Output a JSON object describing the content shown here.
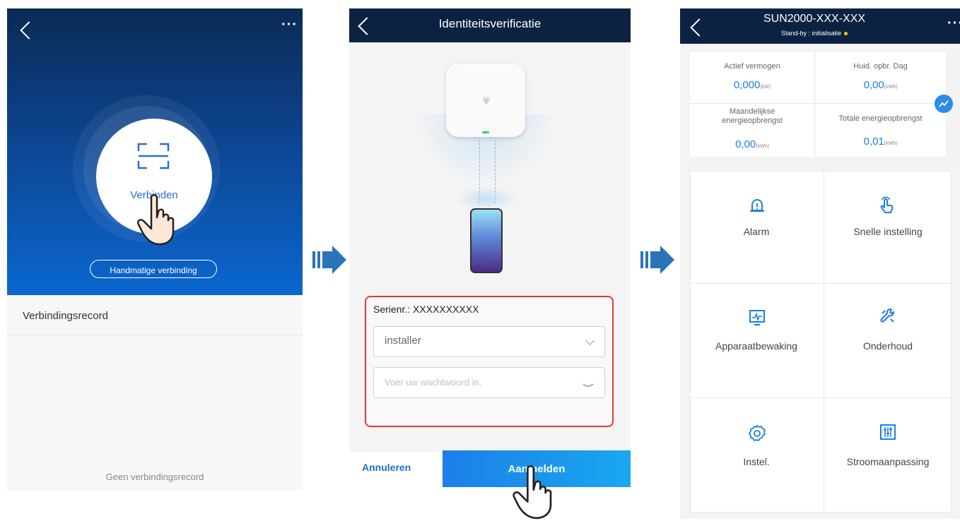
{
  "screen1": {
    "connect_label": "Verbinden",
    "manual_button": "Handmatige verbinding",
    "record_title": "Verbindingsrecord",
    "empty_text": "Geen verbindingsrecord",
    "menu_icon": "more-dots-icon",
    "back_icon": "back-chevron-icon"
  },
  "screen2": {
    "title": "Identiteitsverificatie",
    "serial_label": "Serienr.:",
    "serial_value": "XXXXXXXXXX",
    "user_value": "installer",
    "password_placeholder": "Voer uw wachtwoord in.",
    "cancel_label": "Annuleren",
    "login_label": "Aanmelden"
  },
  "screen3": {
    "title": "SUN2000-XXX-XXX",
    "status": "Stand-by : initialisatie",
    "stats": [
      {
        "label": "Actief vermogen",
        "value": "0,000",
        "unit": "(kW)"
      },
      {
        "label": "Huid. opbr. Dag",
        "value": "0,00",
        "unit": "(kWh)"
      },
      {
        "label": "Maandelijkse energieopbrengst",
        "value": "0,00",
        "unit": "(kWh)"
      },
      {
        "label": "Totale energieopbrengst",
        "value": "0,01",
        "unit": "(kWh)"
      }
    ],
    "tiles": [
      {
        "label": "Alarm",
        "icon": "bell-icon"
      },
      {
        "label": "Snelle instelling",
        "icon": "touch-hand-icon"
      },
      {
        "label": "Apparaatbewaking",
        "icon": "monitor-icon"
      },
      {
        "label": "Onderhoud",
        "icon": "wrench-icon"
      },
      {
        "label": "Instel.",
        "icon": "gear-icon"
      },
      {
        "label": "Stroomaanpassing",
        "icon": "sliders-icon"
      }
    ]
  },
  "colors": {
    "hero_top": "#0b2a55",
    "hero_bottom": "#0a67cf",
    "topbar": "#0b2242",
    "accent": "#1a7fe0",
    "highlight_border": "#e53935"
  }
}
